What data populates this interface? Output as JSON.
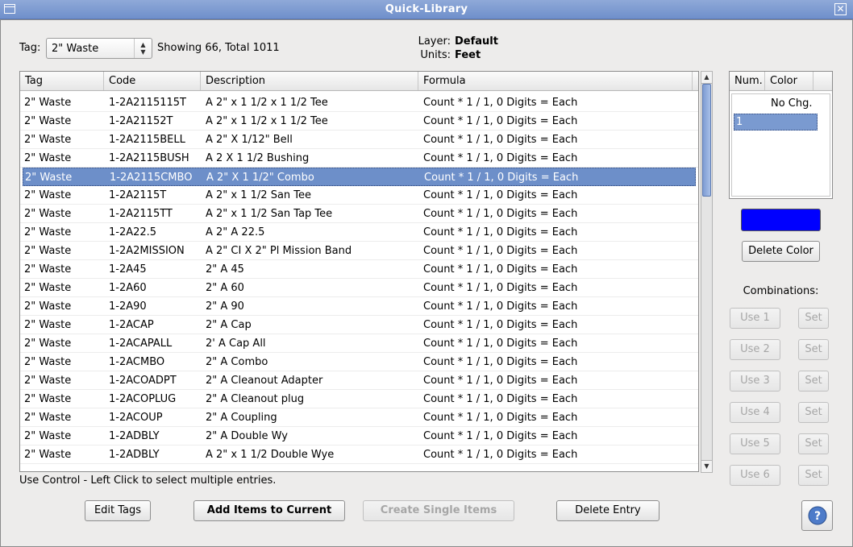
{
  "window": {
    "title": "Quick-Library"
  },
  "filter": {
    "tag_label": "Tag:",
    "tag_value": "2\" Waste",
    "showing_text": "Showing 66, Total 1011",
    "layer_label": "Layer:",
    "layer_value": "Default",
    "units_label": "Units:",
    "units_value": "Feet"
  },
  "table": {
    "columns": [
      "Tag",
      "Code",
      "Description",
      "Formula"
    ],
    "rows": [
      {
        "tag": "2\" Waste",
        "code": "1-2A2115115T",
        "desc": "A 2\" x 1 1/2 x 1 1/2 Tee",
        "formula": "Count * 1 / 1,  0 Digits = Each"
      },
      {
        "tag": "2\" Waste",
        "code": "1-2A21152T",
        "desc": "A 2\" x 1 1/2 x 1 1/2 Tee",
        "formula": "Count * 1 / 1,  0 Digits = Each"
      },
      {
        "tag": "2\" Waste",
        "code": "1-2A2115BELL",
        "desc": "A 2\" X 1/12\" Bell",
        "formula": "Count * 1 / 1,  0 Digits = Each"
      },
      {
        "tag": "2\" Waste",
        "code": "1-2A2115BUSH",
        "desc": "A 2 X 1 1/2 Bushing",
        "formula": "Count * 1 / 1,  0 Digits = Each"
      },
      {
        "tag": "2\" Waste",
        "code": "1-2A2115CMBO",
        "desc": "A 2\" X 1 1/2\" Combo",
        "formula": "Count * 1 / 1,  0 Digits = Each",
        "selected": true
      },
      {
        "tag": "2\" Waste",
        "code": "1-2A2115T",
        "desc": "A 2\" x 1 1/2 San Tee",
        "formula": "Count * 1 / 1,  0 Digits = Each"
      },
      {
        "tag": "2\" Waste",
        "code": "1-2A2115TT",
        "desc": "A 2\" x 1 1/2 San  Tap Tee",
        "formula": "Count * 1 / 1,  0 Digits = Each"
      },
      {
        "tag": "2\" Waste",
        "code": "1-2A22.5",
        "desc": "A 2\" A 22.5",
        "formula": "Count * 1 / 1,  0 Digits = Each"
      },
      {
        "tag": "2\" Waste",
        "code": "1-2A2MISSION",
        "desc": "A 2\" CI X 2\" Pl Mission Band",
        "formula": "Count * 1 / 1,  0 Digits = Each"
      },
      {
        "tag": "2\" Waste",
        "code": "1-2A45",
        "desc": "2\"  A 45",
        "formula": "Count * 1 / 1,  0 Digits = Each"
      },
      {
        "tag": "2\" Waste",
        "code": "1-2A60",
        "desc": "2\" A 60",
        "formula": "Count * 1 / 1,  0 Digits = Each"
      },
      {
        "tag": "2\" Waste",
        "code": "1-2A90",
        "desc": "2\" A 90",
        "formula": "Count * 1 / 1,  0 Digits = Each"
      },
      {
        "tag": "2\" Waste",
        "code": "1-2ACAP",
        "desc": "2\" A Cap",
        "formula": "Count * 1 / 1,  0 Digits = Each"
      },
      {
        "tag": "2\" Waste",
        "code": "1-2ACAPALL",
        "desc": "2'  A Cap All",
        "formula": "Count * 1 / 1,  0 Digits = Each"
      },
      {
        "tag": "2\" Waste",
        "code": "1-2ACMBO",
        "desc": "2\" A Combo",
        "formula": "Count * 1 / 1,  0 Digits = Each"
      },
      {
        "tag": "2\" Waste",
        "code": "1-2ACOADPT",
        "desc": "2\"  A Cleanout Adapter",
        "formula": "Count * 1 / 1,  0 Digits = Each"
      },
      {
        "tag": "2\" Waste",
        "code": "1-2ACOPLUG",
        "desc": "2\"  A Cleanout plug",
        "formula": "Count * 1 / 1,  0 Digits = Each"
      },
      {
        "tag": "2\" Waste",
        "code": "1-2ACOUP",
        "desc": "2\" A Coupling",
        "formula": "Count * 1 / 1,  0 Digits = Each"
      },
      {
        "tag": "2\" Waste",
        "code": "1-2ADBLY",
        "desc": "2\" A Double Wy",
        "formula": "Count * 1 / 1,  0 Digits = Each"
      },
      {
        "tag": "2\" Waste",
        "code": "1-2ADBLY",
        "desc": "A 2\" x 1 1/2 Double Wye",
        "formula": "Count * 1 / 1,  0 Digits = Each"
      }
    ]
  },
  "hint": "Use Control - Left Click to select multiple entries.",
  "buttons": {
    "edit_tags": "Edit Tags",
    "add_items": "Add Items to Current",
    "create_single": "Create Single Items",
    "delete_entry": "Delete Entry"
  },
  "color_panel": {
    "columns": [
      "Num.",
      "Color"
    ],
    "no_change": "No Chg.",
    "selected_num": "1",
    "swatch_color": "#0000ff",
    "delete_color": "Delete Color",
    "combinations_label": "Combinations:",
    "use_buttons": [
      "Use 1",
      "Use 2",
      "Use 3",
      "Use 4",
      "Use 5",
      "Use 6"
    ],
    "set_label": "Set"
  },
  "icons": {
    "help": "help-icon",
    "close": "close-icon",
    "window_menu": "window-menu-icon"
  }
}
